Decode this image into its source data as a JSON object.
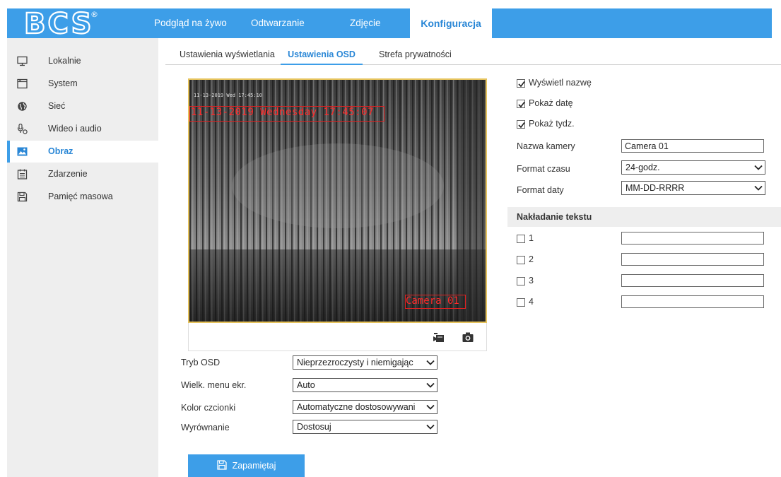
{
  "brand": {
    "logo_text": "BCS",
    "registered_mark": "®"
  },
  "nav": {
    "live_view": "Podgląd na żywo",
    "playback": "Odtwarzanie",
    "picture": "Zdjęcie",
    "configuration": "Konfiguracja"
  },
  "sidebar": {
    "items": [
      {
        "label": "Lokalnie",
        "icon": "monitor-icon"
      },
      {
        "label": "System",
        "icon": "system-icon"
      },
      {
        "label": "Sieć",
        "icon": "globe-icon"
      },
      {
        "label": "Wideo i audio",
        "icon": "mic-icon"
      },
      {
        "label": "Obraz",
        "icon": "image-icon",
        "active": true
      },
      {
        "label": "Zdarzenie",
        "icon": "calendar-icon"
      },
      {
        "label": "Pamięć masowa",
        "icon": "storage-icon"
      }
    ]
  },
  "tabs": {
    "display_settings": "Ustawienia wyświetlania",
    "osd_settings": "Ustawienia OSD",
    "privacy_zone": "Strefa prywatności"
  },
  "video": {
    "osd_small": "11-13-2019 Wed 17:45:10",
    "osd_date": "11-13-2019 Wednesday 17:45:07",
    "osd_camera_name": "Camera 01"
  },
  "form": {
    "osd_mode_label": "Tryb OSD",
    "osd_mode_value": "Nieprzezroczysty i niemigając",
    "menu_size_label": "Wielk. menu ekr.",
    "menu_size_value": "Auto",
    "font_color_label": "Kolor czcionki",
    "font_color_value": "Automatyczne dostosowywani",
    "alignment_label": "Wyrównanie",
    "alignment_value": "Dostosuj",
    "save_label": "Zapamiętaj"
  },
  "right": {
    "show_name_label": "Wyświetl nazwę",
    "show_name_checked": true,
    "show_date_label": "Pokaż datę",
    "show_date_checked": true,
    "show_week_label": "Pokaż tydz.",
    "show_week_checked": true,
    "camera_name_label": "Nazwa kamery",
    "camera_name_value": "Camera 01",
    "time_format_label": "Format czasu",
    "time_format_value": "24-godz.",
    "date_format_label": "Format daty",
    "date_format_value": "MM-DD-RRRR",
    "text_overlay_title": "Nakładanie tekstu",
    "overlay_rows": [
      {
        "label": "1",
        "checked": false,
        "value": ""
      },
      {
        "label": "2",
        "checked": false,
        "value": ""
      },
      {
        "label": "3",
        "checked": false,
        "value": ""
      },
      {
        "label": "4",
        "checked": false,
        "value": ""
      }
    ]
  },
  "colors": {
    "accent": "#3d9ee8",
    "active_text": "#2a87d6",
    "osd_red": "#ff2a2a",
    "video_border": "#e6c35c"
  }
}
